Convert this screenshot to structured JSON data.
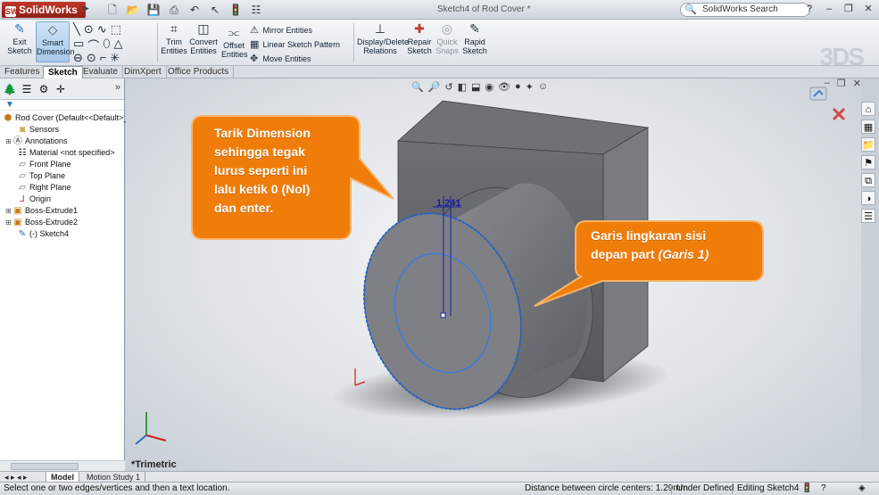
{
  "app": {
    "name": "SolidWorks",
    "document_title": "Sketch4 of Rod Cover *"
  },
  "search": {
    "placeholder": "SolidWorks Search"
  },
  "commands": {
    "exit_sketch": "Exit Sketch",
    "smart_dimension": "Smart Dimension",
    "trim_entities": "Trim Entities",
    "convert_entities": "Convert Entities",
    "offset_entities": "Offset Entities",
    "mirror_entities": "Mirror Entities",
    "linear_sketch_pattern": "Linear Sketch Pattern",
    "move_entities": "Move Entities",
    "display_delete_relations": "Display/Delete Relations",
    "repair_sketch": "Repair Sketch",
    "quick_snaps": "Quick Snaps",
    "rapid_sketch": "Rapid Sketch"
  },
  "tabs": [
    "Features",
    "Sketch",
    "Evaluate",
    "DimXpert",
    "Office Products"
  ],
  "active_tab": "Sketch",
  "tree": {
    "root": "Rod Cover  (Default<<Default>_",
    "items": [
      {
        "label": "Sensors",
        "icon": "sensor-icon"
      },
      {
        "label": "Annotations",
        "icon": "annotation-icon"
      },
      {
        "label": "Material <not specified>",
        "icon": "material-icon"
      },
      {
        "label": "Front Plane",
        "icon": "plane-icon"
      },
      {
        "label": "Top Plane",
        "icon": "plane-icon"
      },
      {
        "label": "Right Plane",
        "icon": "plane-icon"
      },
      {
        "label": "Origin",
        "icon": "origin-icon"
      },
      {
        "label": "Boss-Extrude1",
        "icon": "extrude-icon"
      },
      {
        "label": "Boss-Extrude2",
        "icon": "extrude-icon"
      },
      {
        "label": "(-) Sketch4",
        "icon": "sketch-icon"
      }
    ]
  },
  "viewport": {
    "view_name": "*Trimetric",
    "dimension_value": "1.241",
    "callout_1": {
      "lines": [
        "Tarik Dimension",
        "sehingga tegak",
        "lurus seperti ini",
        "lalu ketik 0 (Nol)",
        "dan enter."
      ]
    },
    "callout_2": {
      "line1": "Garis lingkaran  sisi",
      "line2_prefix": "depan part ",
      "line2_emph": "(Garis 1)"
    }
  },
  "bottom_tabs": [
    "Model",
    "Motion Study 1"
  ],
  "status": {
    "message": "Select one or two edges/vertices and then a text location.",
    "distance": "Distance between circle centers: 1.29mm",
    "definition": "Under Defined",
    "editing": "Editing Sketch4"
  },
  "colors": {
    "callout_orange": "#f07d0a",
    "sketch_blue": "#1e64d8",
    "part_gray": "#7d7f84",
    "accent_red": "#c0392b"
  }
}
